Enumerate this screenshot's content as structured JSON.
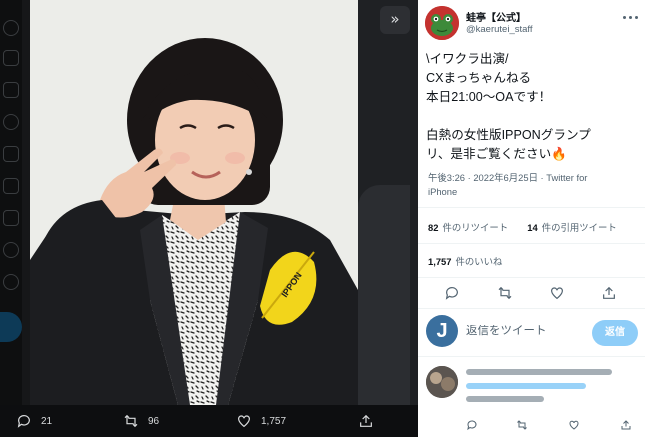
{
  "viewer": {
    "stats": {
      "replies": "21",
      "retweets": "96",
      "likes": "1,757"
    },
    "icons": [
      "expand-icon",
      "reply-icon",
      "retweet-icon",
      "like-icon",
      "share-icon"
    ]
  },
  "tweet": {
    "display_name": "蛙亭【公式】",
    "handle": "@kaerutei_staff",
    "lines": [
      "\\イワクラ出演/",
      "CXまっちゃんねる",
      "本日21:00〜OAです！",
      "",
      "白熱の女性版IPPONグランプ",
      "リ、是非ご覧ください🔥"
    ],
    "meta_line1": "午後3:26 · 2022年6月25日 · Twitter for",
    "meta_line2": "iPhone",
    "retweets_count": "82",
    "retweets_label": "件のリツイート",
    "quotes_count": "14",
    "quotes_label": "件の引用ツイート",
    "likes_count": "1,757",
    "likes_label": "件のいいね"
  },
  "reply": {
    "avatar_letter": "J",
    "placeholder": "返信をツイート",
    "button_label": "返信"
  },
  "colors": {
    "accent": "#1d9bf0",
    "reply_button": "#8ecdf8",
    "muted_text": "#536471"
  }
}
